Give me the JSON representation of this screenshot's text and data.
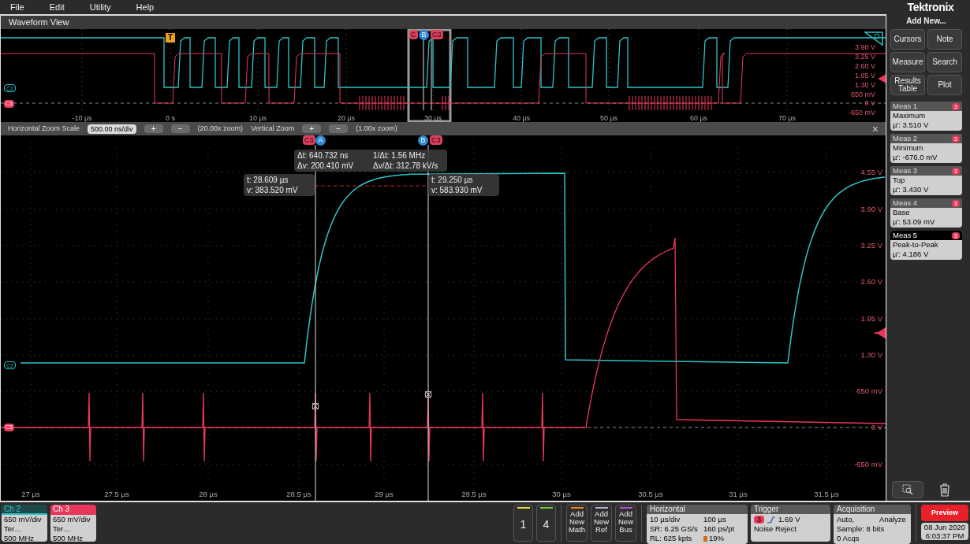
{
  "menu": [
    "File",
    "Edit",
    "Utility",
    "Help"
  ],
  "brand": "Tektronix",
  "waveform_view": {
    "title": "Waveform View",
    "overview": {
      "x_labels": [
        "-10 µs",
        "0 s",
        "10 µs",
        "20 µs",
        "30 µs",
        "40 µs",
        "50 µs",
        "60 µs",
        "70 µs"
      ],
      "y_labels": [
        "3.90 V",
        "3.25 V",
        "2.60 V",
        "1.95 V",
        "1.30 V",
        "650 mV",
        "0 V",
        "-650 mV"
      ],
      "trigger_marker": "T",
      "cursor_markers": [
        {
          "label": "C",
          "kind": "channel"
        },
        {
          "label": "B",
          "kind": "cursor"
        },
        {
          "label": "C3",
          "kind": "channel"
        }
      ],
      "channel_markers": [
        {
          "label": "C2",
          "selected": false
        },
        {
          "label": "C3",
          "selected": true
        }
      ]
    },
    "zoom_bar": {
      "h_label": "Horizontal Zoom Scale",
      "h_value": "500.00 ns/div",
      "plus": "+",
      "minus": "−",
      "h_zoom": "(20.00x zoom)",
      "v_label": "Vertical Zoom",
      "v_zoom": "(1.00x zoom)",
      "close": "×"
    },
    "main": {
      "x_labels": [
        "27 µs",
        "27.5 µs",
        "28 µs",
        "28.5 µs",
        "29 µs",
        "29.5 µs",
        "30 µs",
        "30.5 µs",
        "31 µs",
        "31.5 µs"
      ],
      "y_labels": [
        "4.55 V",
        "3.90 V",
        "3.25 V",
        "2.60 V",
        "1.95 V",
        "1.30 V",
        "650 mV",
        "0 V",
        "-650 mV"
      ],
      "cursor_markers": [
        {
          "label": "C3",
          "kind": "channel"
        },
        {
          "label": "A",
          "kind": "cursor"
        },
        {
          "label": "B",
          "kind": "cursor"
        },
        {
          "label": "C3",
          "kind": "channel"
        }
      ],
      "channel_markers": [
        {
          "label": "C2",
          "selected": false
        },
        {
          "label": "C3",
          "selected": true
        }
      ],
      "delta_readout": [
        "Δt: 640.732 ns",
        "1/Δt: 1.56 MHz",
        "Δv: 200.410 mV",
        "Δv/Δt: 312.78 kV/s"
      ],
      "cursor_a": [
        "t: 28.609 µs",
        "v: 383.520 mV"
      ],
      "cursor_b": [
        "t: 29.250 µs",
        "v: 583.930 mV"
      ]
    }
  },
  "side_panel": {
    "title": "Add New...",
    "buttons": [
      "Cursors",
      "Note",
      "Measure",
      "Search",
      "Results Table",
      "Plot"
    ],
    "measurements": [
      {
        "header": "Meas 1",
        "source": "3",
        "name": "Maximum",
        "value": "µ': 3.510 V",
        "selected": false
      },
      {
        "header": "Meas 2",
        "source": "3",
        "name": "Minimum",
        "value": "µ': -676.0 mV",
        "selected": false
      },
      {
        "header": "Meas 3",
        "source": "3",
        "name": "Top",
        "value": "µ': 3.430 V",
        "selected": false
      },
      {
        "header": "Meas 4",
        "source": "3",
        "name": "Base",
        "value": "µ': 53.09 mV",
        "selected": false
      },
      {
        "header": "Meas 5",
        "source": "3",
        "name": "Peak-to-Peak",
        "value": "µ': 4.186 V",
        "selected": true
      }
    ]
  },
  "bottom_bar": {
    "channels": [
      {
        "label": "Ch 2",
        "color": "#2ec4c8",
        "selected": false,
        "lines": [
          "650 mV/div",
          "Ter…",
          "500 MHz"
        ]
      },
      {
        "label": "Ch 3",
        "color": "#e8375a",
        "selected": true,
        "lines": [
          "650 mV/div",
          "Ter…",
          "500 MHz"
        ]
      }
    ],
    "channel_buttons": [
      {
        "label": "1",
        "color": "#e3e34a"
      },
      {
        "label": "4",
        "color": "#6fcf3a"
      }
    ],
    "add_buttons": [
      {
        "label": "Add New Math",
        "color": "#f08a24"
      },
      {
        "label": "Add New Ref",
        "color": "#b8b8c8"
      },
      {
        "label": "Add New Bus",
        "color": "#b45ad8"
      }
    ],
    "horizontal": {
      "title": "Horizontal",
      "cells": [
        "10 µs/div",
        "100 µs",
        "SR: 6.25 GS/s",
        "160 ps/pt",
        "RL: 625 kpts",
        "19%"
      ]
    },
    "trigger": {
      "title": "Trigger",
      "source": "3",
      "threshold": "1.69 V",
      "mode": "Noise Reject"
    },
    "acquisition": {
      "title": "Acquisition",
      "cells": [
        "Auto,",
        "Analyze",
        "Sample: 8 bits",
        "0 Acqs"
      ]
    },
    "preview": "Preview",
    "date": "08 Jun 2020",
    "time": "6:03:37 PM"
  }
}
